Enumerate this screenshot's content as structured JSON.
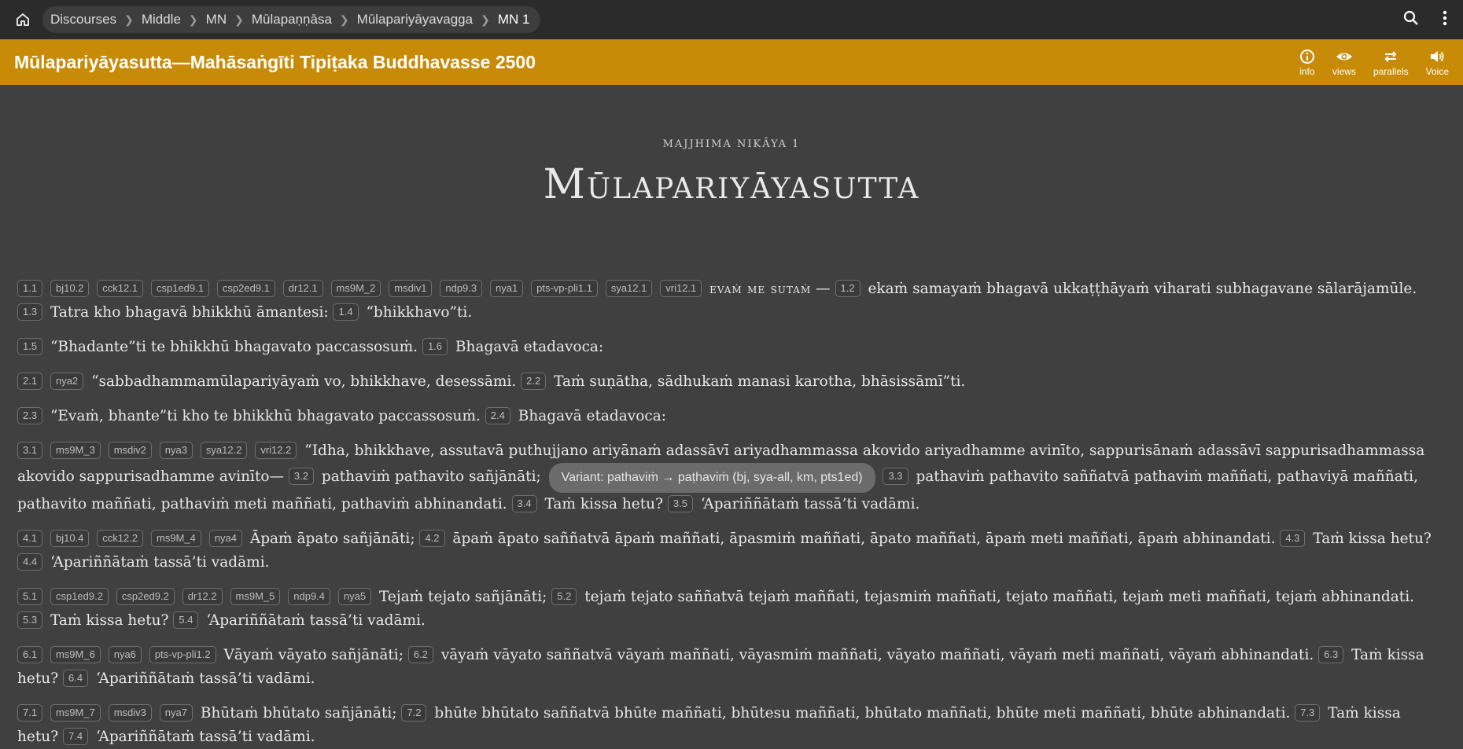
{
  "breadcrumb": [
    "Discourses",
    "Middle",
    "MN",
    "Mūlapaṇṇāsa",
    "Mūlapariyāyavagga",
    "MN 1"
  ],
  "header": {
    "title": "Mūlapariyāyasutta—Mahāsaṅgīti Tipiṭaka Buddhavasse 2500",
    "tools": [
      "info",
      "views",
      "parallels",
      "Voice"
    ]
  },
  "heading": {
    "sub": "MAJJHIMA NIKĀYA 1",
    "main": "Mūlapariyāyasutta"
  },
  "paragraphs": [
    [
      {
        "ref": "1.1"
      },
      {
        "ref": "bj10.2"
      },
      {
        "ref": "cck12.1"
      },
      {
        "ref": "csp1ed9.1"
      },
      {
        "ref": "csp2ed9.1"
      },
      {
        "ref": "dr12.1"
      },
      {
        "ref": "ms9M_2"
      },
      {
        "ref": "msdiv1"
      },
      {
        "ref": "ndp9.3"
      },
      {
        "ref": "nya1"
      },
      {
        "ref": "pts-vp-pli1.1"
      },
      {
        "ref": "sya12.1"
      },
      {
        "ref": "vri12.1"
      },
      {
        "sc": "evaṁ me sutaṁ"
      },
      {
        "text": "— "
      },
      {
        "ref": "1.2"
      },
      {
        "text": "ekaṁ samayaṁ bhagavā ukkaṭṭhāyaṁ viharati subhagavane sālarājamūle. "
      },
      {
        "ref": "1.3"
      },
      {
        "text": "Tatra kho bhagavā bhikkhū āmantesi: "
      },
      {
        "ref": "1.4"
      },
      {
        "text": "“bhikkhavo”ti."
      }
    ],
    [
      {
        "ref": "1.5"
      },
      {
        "text": "“Bhadante”ti te bhikkhū bhagavato paccassosuṁ. "
      },
      {
        "ref": "1.6"
      },
      {
        "text": "Bhagavā etadavoca:"
      }
    ],
    [
      {
        "ref": "2.1"
      },
      {
        "ref": "nya2"
      },
      {
        "text": "“sabbadhammamūlapariyāyaṁ vo, bhikkhave, desessāmi. "
      },
      {
        "ref": "2.2"
      },
      {
        "text": "Taṁ suṇātha, sādhukaṁ manasi karotha, bhāsissāmī”ti."
      }
    ],
    [
      {
        "ref": "2.3"
      },
      {
        "text": "“Evaṁ, bhante”ti kho te bhikkhū bhagavato paccassosuṁ. "
      },
      {
        "ref": "2.4"
      },
      {
        "text": "Bhagavā etadavoca:"
      }
    ],
    [
      {
        "ref": "3.1"
      },
      {
        "ref": "ms9M_3"
      },
      {
        "ref": "msdiv2"
      },
      {
        "ref": "nya3"
      },
      {
        "ref": "sya12.2"
      },
      {
        "ref": "vri12.2"
      },
      {
        "text": "“Idha, bhikkhave, assutavā puthujjano ariyānaṁ adassāvī ariyadhammassa akovido ariyadhamme avinīto, sappurisānaṁ adassāvī sappurisadhammassa akovido sappu­risadhamme avinīto— "
      },
      {
        "ref": "3.2"
      },
      {
        "text": "pathaviṁ pathavito sañjānāti; "
      },
      {
        "variant": "Variant: pathaviṁ → paṭhaviṁ (bj, sya-all, km, pts1ed)"
      },
      {
        "ref": "3.3"
      },
      {
        "text": "pathaviṁ pathavito saññatvā pathaviṁ maññati, pathaviyā maññati, pathavito maññati, pa­thaviṁ meti maññati, pathaviṁ abhinandati. "
      },
      {
        "ref": "3.4"
      },
      {
        "text": "Taṁ kissa hetu? "
      },
      {
        "ref": "3.5"
      },
      {
        "text": "‘Apariññātaṁ tassā’ti vadāmi."
      }
    ],
    [
      {
        "ref": "4.1"
      },
      {
        "ref": "bj10.4"
      },
      {
        "ref": "cck12.2"
      },
      {
        "ref": "ms9M_4"
      },
      {
        "ref": "nya4"
      },
      {
        "text": "Āpaṁ āpato sañjānāti; "
      },
      {
        "ref": "4.2"
      },
      {
        "text": "āpaṁ āpato saññatvā āpaṁ maññati, āpasmiṁ maññati, āpato maññati, āpaṁ meti maññati, āpaṁ abhinandati. "
      },
      {
        "ref": "4.3"
      },
      {
        "text": "Taṁ kissa hetu? "
      },
      {
        "ref": "4.4"
      },
      {
        "text": "‘Apariññātaṁ tassā’ti vadāmi."
      }
    ],
    [
      {
        "ref": "5.1"
      },
      {
        "ref": "csp1ed9.2"
      },
      {
        "ref": "csp2ed9.2"
      },
      {
        "ref": "dr12.2"
      },
      {
        "ref": "ms9M_5"
      },
      {
        "ref": "ndp9.4"
      },
      {
        "ref": "nya5"
      },
      {
        "text": "Tejaṁ tejato sañjānāti; "
      },
      {
        "ref": "5.2"
      },
      {
        "text": "tejaṁ tejato saññatvā tejaṁ maññati, tejasmiṁ maññati, tejato maññati, tejaṁ meti maññati, tejaṁ abhinandati. "
      },
      {
        "ref": "5.3"
      },
      {
        "text": "Taṁ kissa hetu? "
      },
      {
        "ref": "5.4"
      },
      {
        "text": "‘Apariññātaṁ tassā’ti vadāmi."
      }
    ],
    [
      {
        "ref": "6.1"
      },
      {
        "ref": "ms9M_6"
      },
      {
        "ref": "nya6"
      },
      {
        "ref": "pts-vp-pli1.2"
      },
      {
        "text": "Vāyaṁ vāyato sañjānāti; "
      },
      {
        "ref": "6.2"
      },
      {
        "text": "vāyaṁ vāyato saññatvā vāyaṁ maññati, vāyasmiṁ maññati, vāyato maññati, vāyaṁ meti maññati, vāyaṁ abhinandati. "
      },
      {
        "ref": "6.3"
      },
      {
        "text": "Taṁ kissa hetu? "
      },
      {
        "ref": "6.4"
      },
      {
        "text": "‘Apariññātaṁ tassā’ti vadāmi."
      }
    ],
    [
      {
        "ref": "7.1"
      },
      {
        "ref": "ms9M_7"
      },
      {
        "ref": "msdiv3"
      },
      {
        "ref": "nya7"
      },
      {
        "text": "Bhūtaṁ bhūtato sañjānāti; "
      },
      {
        "ref": "7.2"
      },
      {
        "text": "bhūte bhūtato saññatvā bhūte maññati, bhūtesu maññati, bhūtato maññati, bhūte meti maññati, bhūte abhinandati. "
      },
      {
        "ref": "7.3"
      },
      {
        "text": "Taṁ kissa hetu? "
      },
      {
        "ref": "7.4"
      },
      {
        "text": "‘Apariññātaṁ tassā’ti vadāmi."
      }
    ]
  ]
}
